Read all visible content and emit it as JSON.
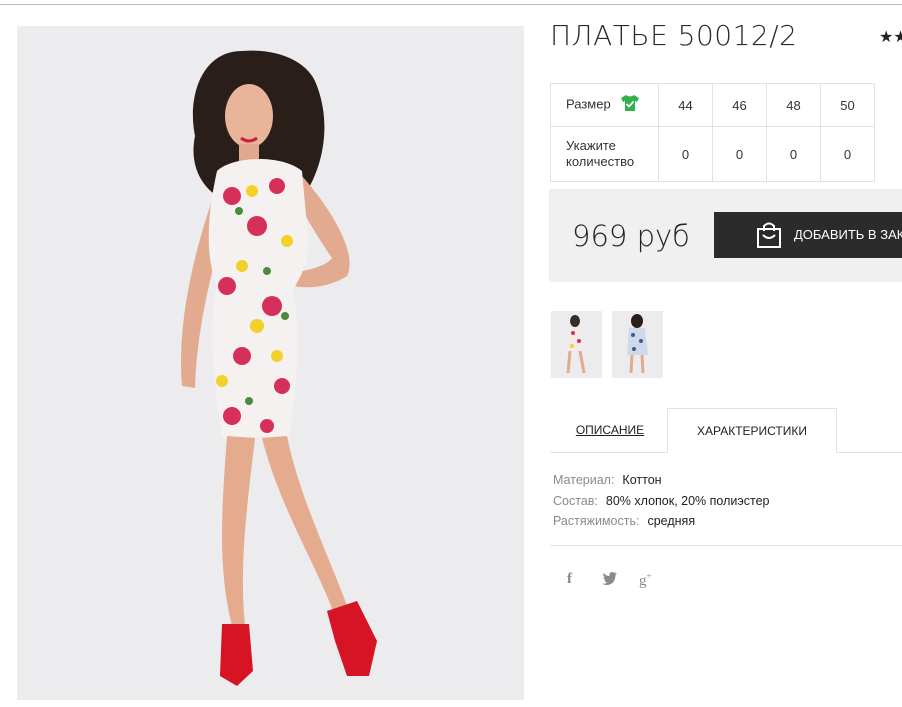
{
  "product": {
    "title": "ПЛАТЬЕ 50012/2",
    "rating_stars": "★★"
  },
  "size_table": {
    "size_label": "Размер",
    "quantity_label": "Укажите количество",
    "sizes": [
      "44",
      "46",
      "48",
      "50"
    ],
    "quantities": [
      "0",
      "0",
      "0",
      "0"
    ]
  },
  "purchase": {
    "price": "969 руб",
    "add_to_cart_label": "ДОБАВИТЬ В ЗАКАЗ"
  },
  "tabs": {
    "description": "ОПИСАНИЕ",
    "characteristics": "ХАРАКТЕРИСТИКИ"
  },
  "specs": [
    {
      "key": "Материал:",
      "value": "Коттон"
    },
    {
      "key": "Состав:",
      "value": "80% хлопок, 20% полиэстер"
    },
    {
      "key": "Растяжимость:",
      "value": "средняя"
    }
  ],
  "social": {
    "facebook": "f",
    "twitter": "🐦",
    "google_plus": "g⁺"
  },
  "icons": {
    "size_shirt": "green-shirt-check-icon",
    "cart": "shopping-bag-icon",
    "social": [
      "facebook-icon",
      "twitter-icon",
      "google-plus-icon"
    ]
  },
  "colors": {
    "accent_green": "#2fb34a",
    "button_dark": "#2b2b2b",
    "buy_box_bg": "#f0f0f0"
  }
}
